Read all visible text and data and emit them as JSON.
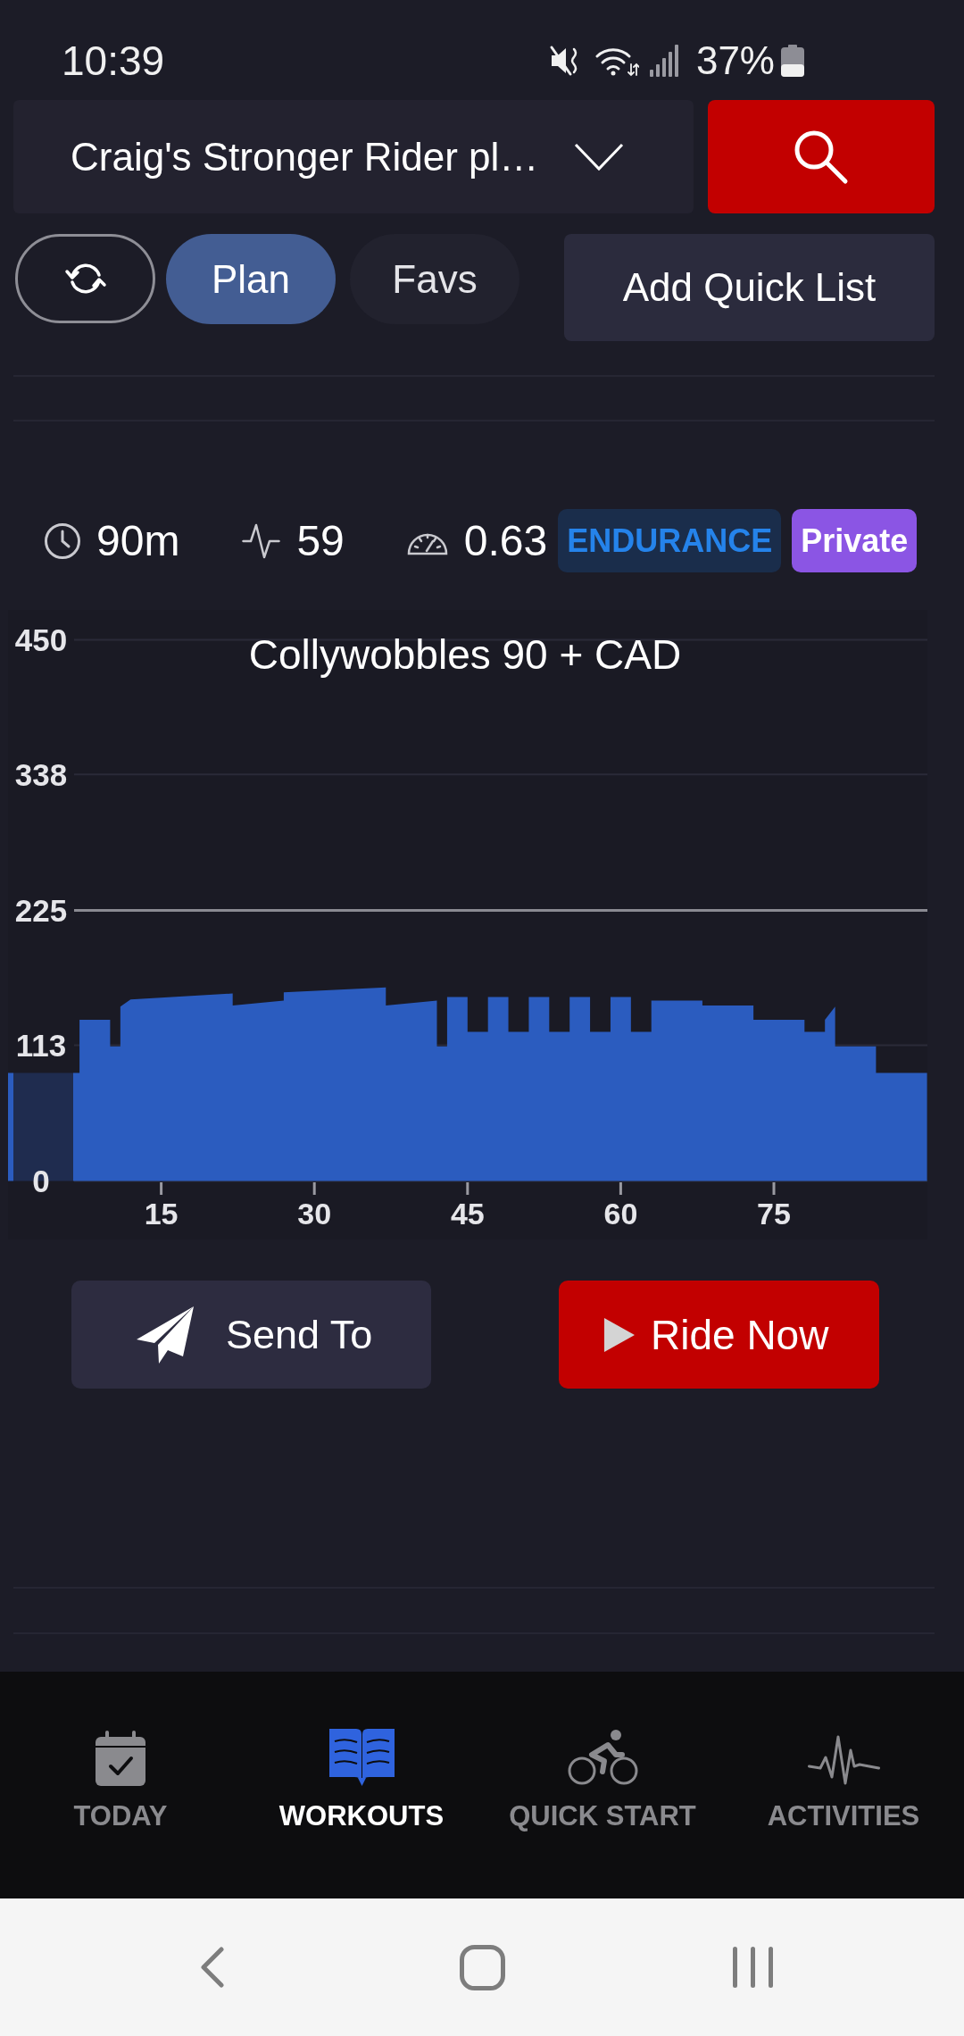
{
  "status_bar": {
    "time": "10:39",
    "battery": "37%"
  },
  "plan_selector": {
    "value": "Craig's Stronger Rider pl…"
  },
  "tabs": [
    {
      "label": "Plan",
      "selected": true
    },
    {
      "label": "Favs",
      "selected": false
    }
  ],
  "add_quick_list": {
    "label": "Add Quick List"
  },
  "workout": {
    "stats": [
      {
        "kind": "time",
        "value": "90m"
      },
      {
        "kind": "load",
        "value": "59"
      },
      {
        "kind": "intensity",
        "value": "0.63"
      }
    ],
    "tags": [
      {
        "kind": "category",
        "label": "ENDURANCE"
      },
      {
        "kind": "visibility",
        "label": "Private"
      }
    ],
    "chart_data": {
      "type": "area",
      "title": "Collywobbles 90 + CAD",
      "x": [
        0,
        7,
        7,
        10,
        10,
        11,
        11,
        12,
        22,
        22,
        27,
        27,
        37,
        37,
        42,
        42,
        43,
        43,
        45,
        45,
        47,
        47,
        49,
        49,
        51,
        51,
        53,
        53,
        55,
        55,
        57,
        57,
        59,
        59,
        61,
        61,
        63,
        63,
        68,
        68,
        73,
        73,
        78,
        78,
        80,
        80,
        81,
        81,
        85,
        85,
        90
      ],
      "series": [
        {
          "color": "#2b5cbf",
          "values": [
            90,
            90,
            134,
            134,
            112,
            112,
            145,
            151,
            156,
            146,
            150,
            157,
            161,
            146,
            150,
            112,
            112,
            153,
            153,
            124,
            124,
            153,
            153,
            124,
            124,
            153,
            153,
            124,
            124,
            153,
            153,
            124,
            124,
            153,
            153,
            124,
            124,
            150,
            150,
            146,
            146,
            134,
            134,
            124,
            124,
            134,
            145,
            112,
            112,
            90,
            90
          ]
        }
      ],
      "xlim": [
        0,
        90
      ],
      "ylim": [
        0,
        450
      ],
      "xticks": [
        15,
        30,
        45,
        60,
        75
      ],
      "yticks": [
        0,
        113,
        225,
        338,
        450
      ],
      "ref_lines": [
        {
          "axis": "y",
          "value": 225,
          "color": "#8a8a92"
        }
      ]
    }
  },
  "actions": [
    {
      "kind": "send",
      "label": "Send To"
    },
    {
      "kind": "ride",
      "label": "Ride Now"
    }
  ],
  "bottom_nav": [
    {
      "kind": "today",
      "label": "TODAY",
      "selected": false
    },
    {
      "kind": "workouts",
      "label": "WORKOUTS",
      "selected": true
    },
    {
      "kind": "quick_start",
      "label": "QUICK START",
      "selected": false
    },
    {
      "kind": "activities",
      "label": "ACTIVITIES",
      "selected": false
    }
  ]
}
